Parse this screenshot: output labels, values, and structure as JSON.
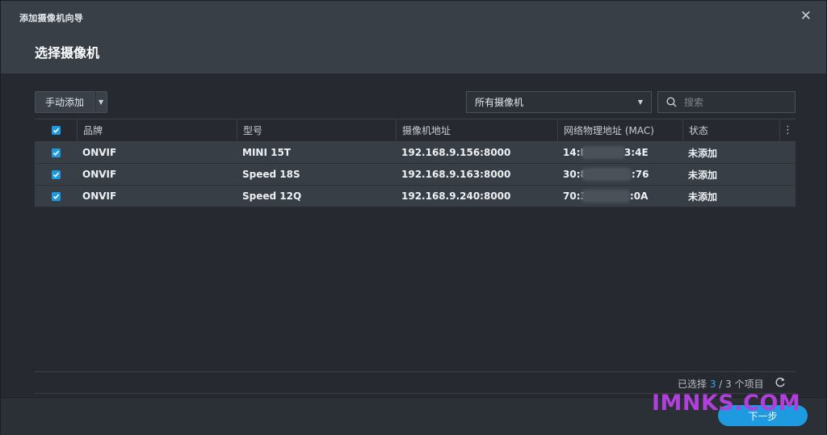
{
  "window": {
    "wizard_title": "添加摄像机向导",
    "step_title": "选择摄像机",
    "close_label": "✕"
  },
  "toolbar": {
    "add_label": "手动添加",
    "filter_value": "所有摄像机",
    "search_placeholder": "搜索"
  },
  "table": {
    "headers": {
      "brand": "品牌",
      "model": "型号",
      "address": "摄像机地址",
      "mac": "网络物理地址 (MAC)",
      "status": "状态"
    },
    "rows": [
      {
        "brand": "ONVIF",
        "model": "MINI 15T",
        "address": "192.168.9.156:8000",
        "mac_start": "14:I",
        "mac_end": "3:4E",
        "status": "未添加",
        "checked": true
      },
      {
        "brand": "ONVIF",
        "model": "Speed 18S",
        "address": "192.168.9.163:8000",
        "mac_start": "30:8",
        "mac_end": ":76",
        "status": "未添加",
        "checked": true
      },
      {
        "brand": "ONVIF",
        "model": "Speed 12Q",
        "address": "192.168.9.240:8000",
        "mac_start": "70:3",
        "mac_end": ":0A",
        "status": "未添加",
        "checked": true
      }
    ]
  },
  "footer": {
    "sel_prefix": "已选择 ",
    "sel_count": "3",
    "sel_suffix": " / 3 个项目",
    "next_label": "下一步"
  },
  "watermark": "IMNKS.COM",
  "colors": {
    "accent": "#1e9be0",
    "watermark": "#b13fdc",
    "header_bg": "#393f47",
    "row_bg": "#383e46"
  }
}
